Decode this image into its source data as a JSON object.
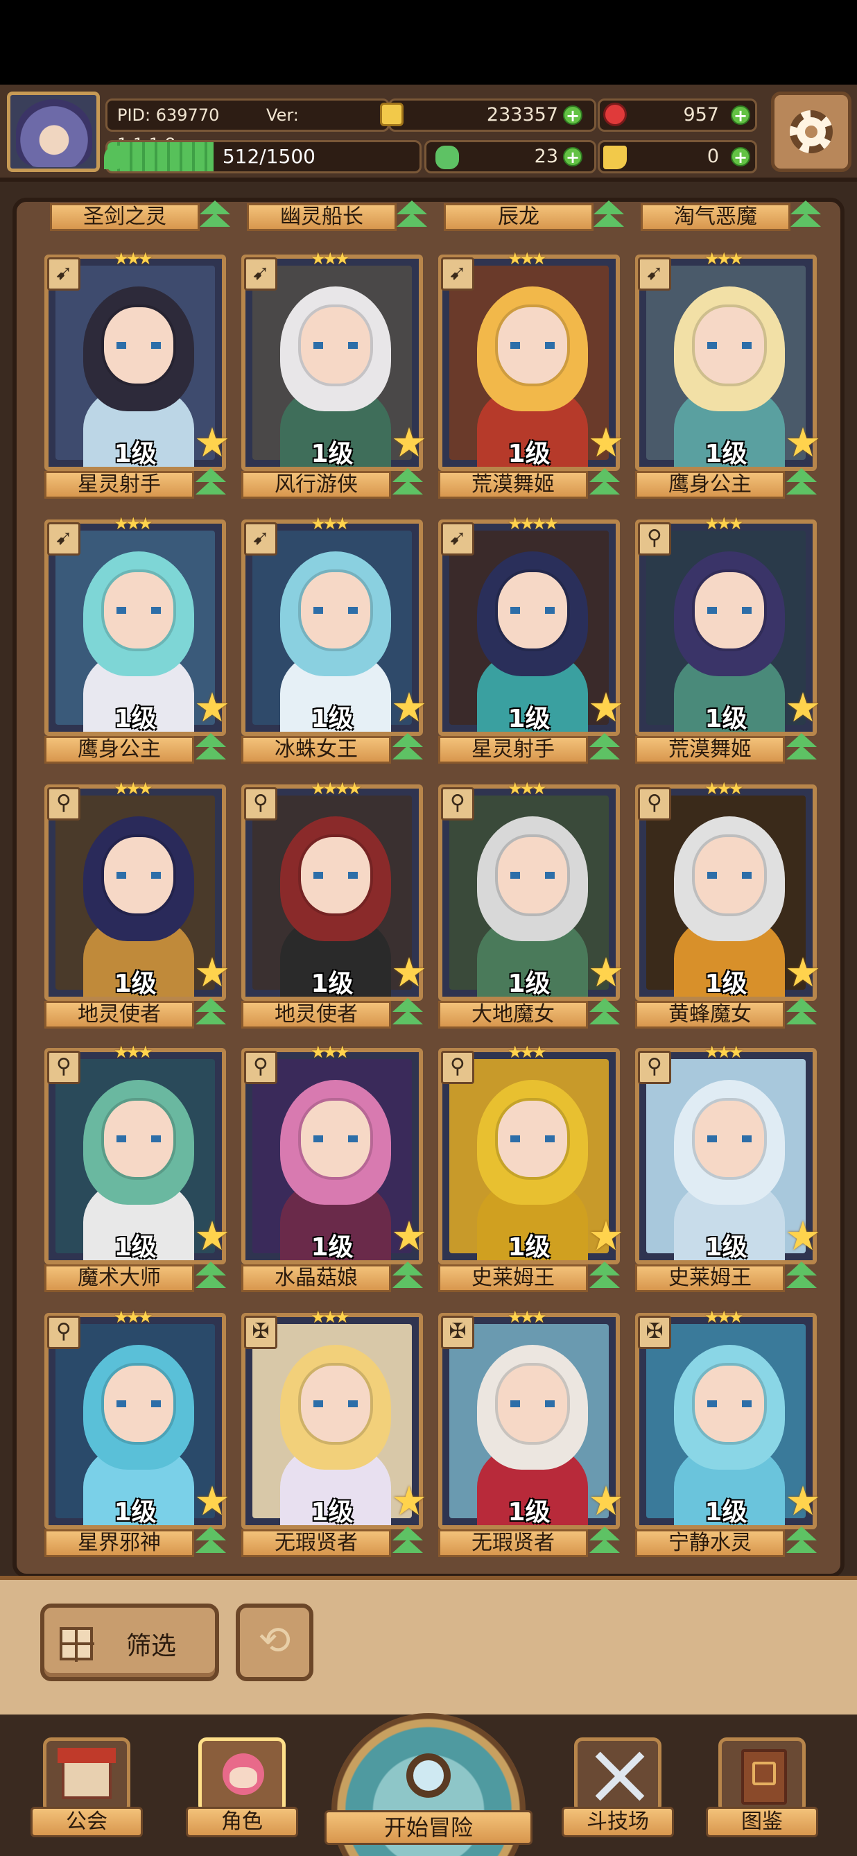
{
  "header": {
    "pid": "PID: 639770",
    "version": "Ver: 1.1.1.8",
    "gold": "233357",
    "gems": "957",
    "energy_text": "512/1500",
    "energy_fill": 0.34,
    "clover": "23",
    "keys": "0"
  },
  "top_row": [
    "圣剑之灵",
    "幽灵船长",
    "辰龙",
    "淘气恶魔"
  ],
  "cards": [
    {
      "name": "星灵射手",
      "level": "1级",
      "stars": "★★★",
      "type": "bow",
      "hair": "#2d2a3a",
      "outfit": "#bcd6e6",
      "bg": "#3e4b6e"
    },
    {
      "name": "风行游侠",
      "level": "1级",
      "stars": "★★★",
      "type": "bow",
      "hair": "#e8e6e8",
      "outfit": "#3f6e5a",
      "bg": "#4a4848"
    },
    {
      "name": "荒漠舞姬",
      "level": "1级",
      "stars": "★★★",
      "type": "bow",
      "hair": "#f2b84a",
      "outfit": "#b63a2a",
      "bg": "#6a3a2a"
    },
    {
      "name": "鹰身公主",
      "level": "1级",
      "stars": "★★★",
      "type": "bow",
      "hair": "#f2e0a6",
      "outfit": "#5aa0a0",
      "bg": "#4a5a6a"
    },
    {
      "name": "鹰身公主",
      "level": "1级",
      "stars": "★★★",
      "type": "bow",
      "hair": "#7ed6d6",
      "outfit": "#e8e8f0",
      "bg": "#3a5a7a"
    },
    {
      "name": "冰蛛女王",
      "level": "1级",
      "stars": "★★★",
      "type": "bow",
      "hair": "#8ad0e0",
      "outfit": "#e6f0f6",
      "bg": "#2f4a6a"
    },
    {
      "name": "星灵射手",
      "level": "1级",
      "stars": "★★★★",
      "type": "bow",
      "hair": "#2a2f5a",
      "outfit": "#3aa0a0",
      "bg": "#3a2a2a"
    },
    {
      "name": "荒漠舞姬",
      "level": "1级",
      "stars": "★★★",
      "type": "wand",
      "hair": "#3a3468",
      "outfit": "#4a8a7a",
      "bg": "#2a3a4a"
    },
    {
      "name": "地灵使者",
      "level": "1级",
      "stars": "★★★",
      "type": "wand",
      "hair": "#2a2a5a",
      "outfit": "#c08a3a",
      "bg": "#4a3a2a"
    },
    {
      "name": "地灵使者",
      "level": "1级",
      "stars": "★★★★",
      "type": "wand",
      "hair": "#8a2a2a",
      "outfit": "#2a2a2a",
      "bg": "#3a3030"
    },
    {
      "name": "大地魔女",
      "level": "1级",
      "stars": "★★★",
      "type": "wand",
      "hair": "#d8d8d8",
      "outfit": "#4a7a5a",
      "bg": "#3a4a3a"
    },
    {
      "name": "黄蜂魔女",
      "level": "1级",
      "stars": "★★★",
      "type": "wand",
      "hair": "#e0e0e0",
      "outfit": "#d8902a",
      "bg": "#3a2a1a"
    },
    {
      "name": "魔术大师",
      "level": "1级",
      "stars": "★★★",
      "type": "wand",
      "hair": "#6ab8a0",
      "outfit": "#e8e8e8",
      "bg": "#2a4a5a"
    },
    {
      "name": "水晶菇娘",
      "level": "1级",
      "stars": "★★★",
      "type": "wand",
      "hair": "#d87ab0",
      "outfit": "#6a2a4a",
      "bg": "#3a2a5a"
    },
    {
      "name": "史莱姆王",
      "level": "1级",
      "stars": "★★★",
      "type": "wand",
      "hair": "#e8c030",
      "outfit": "#d0a020",
      "bg": "#c89a2a"
    },
    {
      "name": "史莱姆王",
      "level": "1级",
      "stars": "★★★",
      "type": "wand",
      "hair": "#e0ecf4",
      "outfit": "#c8dcea",
      "bg": "#a8c8dc"
    },
    {
      "name": "星界邪神",
      "level": "1级",
      "stars": "★★★",
      "type": "wand",
      "hair": "#5ac0d8",
      "outfit": "#7ad0e8",
      "bg": "#2a4a6a"
    },
    {
      "name": "无瑕贤者",
      "level": "1级",
      "stars": "★★★",
      "type": "cross",
      "hair": "#f2d07a",
      "outfit": "#e8e0f0",
      "bg": "#d8c8a8"
    },
    {
      "name": "无瑕贤者",
      "level": "1级",
      "stars": "★★★",
      "type": "cross",
      "hair": "#ece6e0",
      "outfit": "#b82a3a",
      "bg": "#6a9ab0"
    },
    {
      "name": "宁静水灵",
      "level": "1级",
      "stars": "★★★",
      "type": "cross",
      "hair": "#8ad6e6",
      "outfit": "#6ac4dc",
      "bg": "#3a7a9a"
    }
  ],
  "filter": {
    "label": "筛选"
  },
  "nav": {
    "guild": "公会",
    "character": "角色",
    "adventure": "开始冒险",
    "arena": "斗技场",
    "codex": "图鉴"
  }
}
